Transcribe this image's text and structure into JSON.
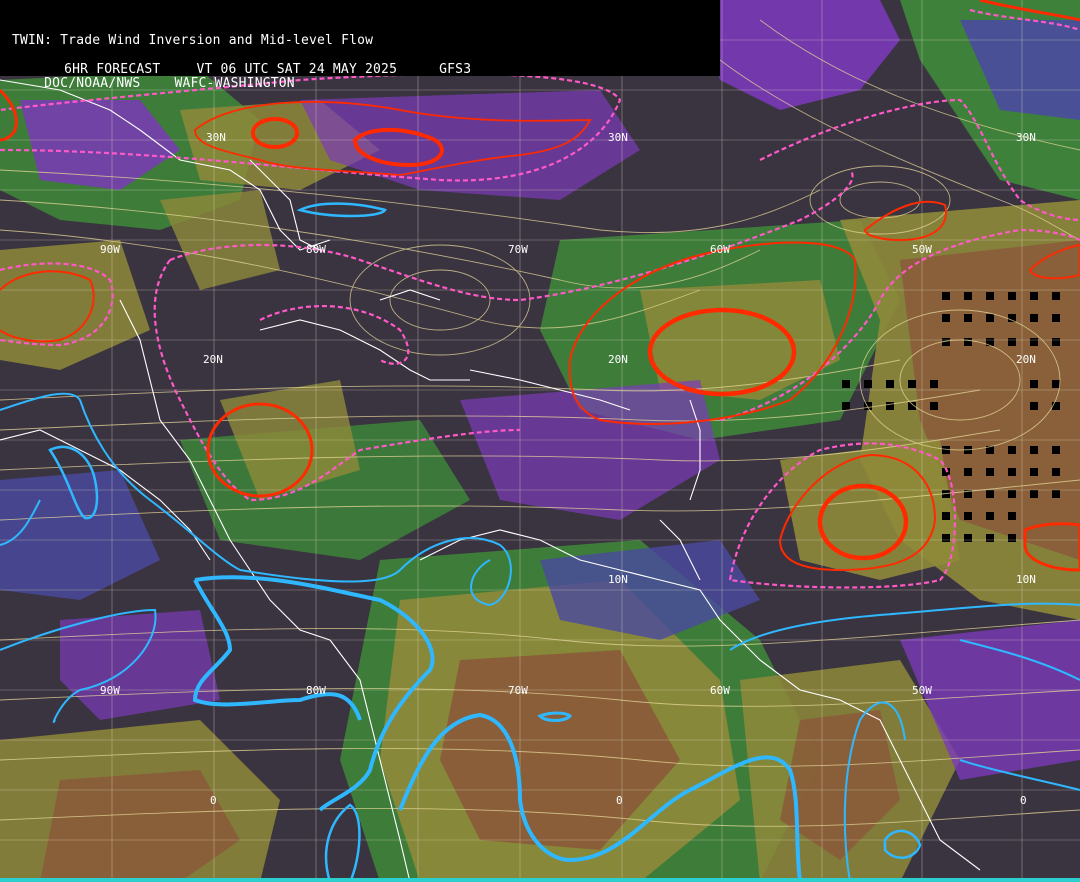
{
  "header": {
    "title": "TWIN: Trade Wind Inversion and Mid-level Flow",
    "forecast": "6HR FORECAST",
    "valid_time": "VT 06 UTC SAT 24 MAY 2025",
    "model": "GFS3",
    "agency": "DOC/NOAA/NWS",
    "center": "WAFC-WASHINGTON"
  },
  "labels": {
    "lat_30n_a": "30N",
    "lat_30n_b": "30N",
    "lat_30n_c": "30N",
    "lat_20n_a": "20N",
    "lat_20n_b": "20N",
    "lat_20n_c": "20N",
    "lat_10n_a": "10N",
    "lat_10n_b": "10N",
    "lat_0_a": "0",
    "lat_0_b": "0",
    "lat_0_c": "0",
    "lon_90w_a": "90W",
    "lon_80w_a": "80W",
    "lon_70w_a": "70W",
    "lon_60w_a": "60W",
    "lon_50w_a": "50W",
    "lon_90w_b": "90W",
    "lon_80w_b": "80W",
    "lon_70w_b": "70W",
    "lon_60w_b": "60W",
    "lon_50w_b": "50W"
  },
  "colors": {
    "background": "#3a3340",
    "inversion_red": "#ff2a00",
    "pink_dashed": "#ff59c8",
    "blue_contour": "#2fb8ff",
    "streamline": "#e6d89a",
    "green": "#3f8a3a",
    "olive": "#8f8a3a",
    "brown": "#8a5a3a",
    "purple": "#7a3ab8"
  }
}
